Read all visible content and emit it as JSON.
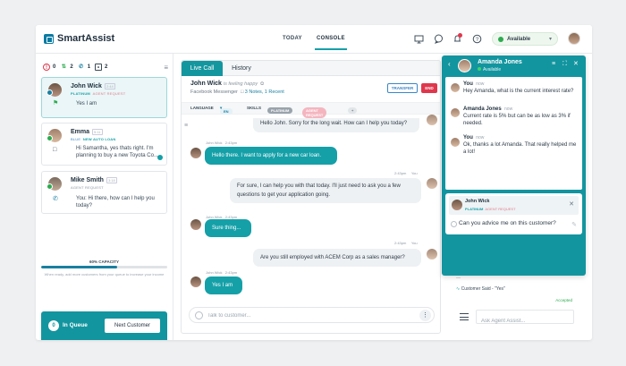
{
  "brand": {
    "name": "SmartAssist"
  },
  "nav": {
    "today": "TODAY",
    "console": "CONSOLE"
  },
  "status": {
    "label": "Available"
  },
  "stats": {
    "missed": "0",
    "transfers": "2",
    "calls": "1",
    "chats": "2"
  },
  "conversations": [
    {
      "name": "John Wick",
      "badge": "2:44",
      "tags": [
        "PLATINUM",
        "AGENT REQUEST"
      ],
      "message": "Yes I am"
    },
    {
      "name": "Emma",
      "badge": "5:11",
      "tags": [
        "BLUE",
        "NEW AUTO LOAN"
      ],
      "message": "Hi Samantha, yes thats right. I'm planning to buy a new Toyota Co..."
    },
    {
      "name": "Mike Smith",
      "badge": "3:18",
      "tags": [
        "AGENT REQUEST"
      ],
      "message": "You: Hi there, how can I help you today?"
    }
  ],
  "capacity": {
    "label": "60% CAPACITY",
    "percent": 60,
    "note": "When ready, add more customers from your queue to increase your income"
  },
  "queue": {
    "count": "0",
    "label": "In Queue",
    "next_button": "Next Customer"
  },
  "tabs": {
    "live": "Live Call",
    "history": "History"
  },
  "chat_header": {
    "name": "John Wick",
    "mood": "is feeling happy",
    "channel": "Facebook Messenger",
    "notes": "3 Notes, 1 Recent",
    "transfer": "TRANSFER",
    "end": "END"
  },
  "tagrow": {
    "language_label": "LANGUAGE",
    "language_value": "EN",
    "skills_label": "SKILLS",
    "skill1": "PLATINUM",
    "skill2": "AGENT REQUEST",
    "add": "+"
  },
  "messages": [
    {
      "from": "agent",
      "text": "Hello John. Sorry for the long wait. How can I help you today?"
    },
    {
      "from": "customer",
      "name": "John Wick",
      "time": "2:43pm",
      "text": "Hello there. I want to apply for a new car loan."
    },
    {
      "from": "agent",
      "time": "2:43pm",
      "name": "You",
      "text": "For sure, I can help you with that today. I'll just need to ask you a few questions to get your application going."
    },
    {
      "from": "customer",
      "name": "John Wick",
      "time": "2:43pm",
      "text": "Sure thing..."
    },
    {
      "from": "agent",
      "time": "2:43pm",
      "name": "You",
      "text": "Are you still employed with ACEM Corp as a sales manager?"
    },
    {
      "from": "customer",
      "name": "John Wick",
      "time": "2:43pm",
      "text": "Yes I am"
    }
  ],
  "compose": {
    "placeholder": "Talk to customer..."
  },
  "assist_panel": {
    "name": "Amanda Jones",
    "status": "Available",
    "messages": [
      {
        "name": "You",
        "time": "now",
        "text": "Hey Amanda, what is the current interest rate?"
      },
      {
        "name": "Amanda Jones",
        "time": "now",
        "text": "Current rate is 5% but can be as low as 3% if needed."
      },
      {
        "name": "You",
        "time": "now",
        "text": "Ok, thanks a lot Amanda. That really helped me a lot!"
      }
    ],
    "suggestion": {
      "name": "John Wick",
      "tag1": "PLATINUM",
      "tag2": "AGENT REQUEST",
      "question": "Can you advice me on this customer?"
    }
  },
  "agent_assist": {
    "said": "Customer Said - \"Yes\"",
    "accepted": "Accepted",
    "placeholder": "Ask Agent Assist..."
  },
  "colors": {
    "teal": "#15a0a8",
    "teal_dark": "#13959f",
    "red": "#e0364c",
    "green": "#2cab4f"
  }
}
